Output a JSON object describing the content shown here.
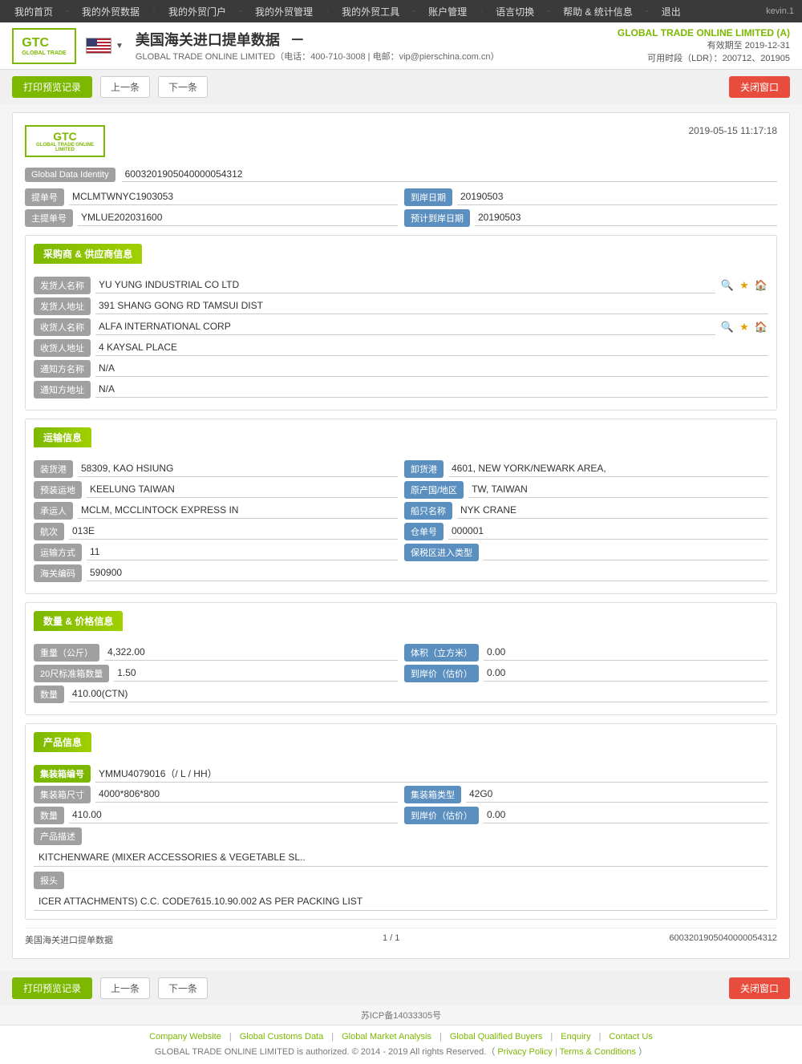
{
  "nav": {
    "items": [
      "我的首页",
      "我的外贸数据",
      "我的外贸门户",
      "我的外贸管理",
      "我的外贸工具",
      "账户管理",
      "语言切换",
      "帮助 & 统计信息",
      "退出"
    ],
    "user": "kevin.1"
  },
  "header": {
    "logo_text": "GTC",
    "logo_sub": "GLOBAL TRADE ONLINE LIMITED",
    "flag_alt": "US Flag",
    "title": "美国海关进口提单数据",
    "dash": "－",
    "subtitle": "GLOBAL TRADE ONLINE LIMITED（电话：400-710-3008 | 电邮：vip@pierschina.com.cn）",
    "company_name": "GLOBAL TRADE ONLINE LIMITED (A)",
    "valid_until": "有效期至 2019-12-31",
    "ldr": "可用时段（LDR）：200712、201905"
  },
  "toolbar": {
    "print_label": "打印预览记录",
    "prev_label": "上一条",
    "next_label": "下一条",
    "close_label": "关闭窗口"
  },
  "record": {
    "timestamp": "2019-05-15 11:17:18",
    "gdi_label": "Global Data Identity",
    "gdi_value": "6003201905040000054312",
    "bill_no_label": "提单号",
    "bill_no_value": "MCLMTWNYC1903053",
    "arrival_date_label": "到岸日期",
    "arrival_date_value": "20190503",
    "master_bill_label": "主提单号",
    "master_bill_value": "YMLUE202031600",
    "est_arrival_label": "预计到岸日期",
    "est_arrival_value": "20190503",
    "buyer_supplier": {
      "section_title": "采购商 & 供应商信息",
      "shipper_label": "发货人名称",
      "shipper_value": "YU YUNG INDUSTRIAL CO LTD",
      "shipper_addr_label": "发货人地址",
      "shipper_addr_value": "391 SHANG GONG RD TAMSUI DIST",
      "consignee_label": "收货人名称",
      "consignee_value": "ALFA INTERNATIONAL CORP",
      "consignee_addr_label": "收货人地址",
      "consignee_addr_value": "4 KAYSAL PLACE",
      "notify_label": "通知方名称",
      "notify_value": "N/A",
      "notify_addr_label": "通知方地址",
      "notify_addr_value": "N/A"
    },
    "transport": {
      "section_title": "运输信息",
      "loading_port_label": "装货港",
      "loading_port_value": "58309, KAO HSIUNG",
      "unloading_port_label": "卸货港",
      "unloading_port_value": "4601, NEW YORK/NEWARK AREA,",
      "pre_dest_label": "预装运地",
      "pre_dest_value": "KEELUNG TAIWAN",
      "origin_label": "原产国/地区",
      "origin_value": "TW, TAIWAN",
      "carrier_label": "承运人",
      "carrier_value": "MCLM, MCCLINTOCK EXPRESS IN",
      "vessel_label": "船只名称",
      "vessel_value": "NYK CRANE",
      "voyage_label": "航次",
      "voyage_value": "013E",
      "bill_no2_label": "仓单号",
      "bill_no2_value": "000001",
      "transport_mode_label": "运输方式",
      "transport_mode_value": "11",
      "ftz_label": "保税区进入类型",
      "ftz_value": "",
      "customs_code_label": "海关编码",
      "customs_code_value": "590900"
    },
    "quantity_price": {
      "section_title": "数量 & 价格信息",
      "weight_label": "重量（公斤）",
      "weight_value": "4,322.00",
      "volume_label": "体积（立方米）",
      "volume_value": "0.00",
      "std20_label": "20尺标准箱数量",
      "std20_value": "1.50",
      "landed_price_label": "到岸价（估价）",
      "landed_price_value": "0.00",
      "qty_label": "数量",
      "qty_value": "410.00(CTN)"
    },
    "product": {
      "section_title": "产品信息",
      "container_no_label": "集装箱编号",
      "container_no_value": "YMMU4079016（/ L / HH）",
      "container_size_label": "集装箱尺寸",
      "container_size_value": "4000*806*800",
      "container_type_label": "集装箱类型",
      "container_type_value": "42G0",
      "qty2_label": "数量",
      "qty2_value": "410.00",
      "landed_price2_label": "到岸价（估价）",
      "landed_price2_value": "0.00",
      "desc_label": "产品描述",
      "desc_value": "KITCHENWARE (MIXER ACCESSORIES & VEGETABLE SL..",
      "header_label": "报头",
      "header_value": "ICER ATTACHMENTS) C.C. CODE7615.10.90.002 AS PER PACKING LIST"
    },
    "footer": {
      "page_title": "美国海关进口提单数据",
      "page_num": "1 / 1",
      "record_id": "6003201905040000054312"
    }
  },
  "site_footer": {
    "icp": "苏ICP备14033305号",
    "links": [
      "Company Website",
      "Global Customs Data",
      "Global Market Analysis",
      "Global Qualified Buyers",
      "Enquiry",
      "Contact Us"
    ],
    "copyright": "GLOBAL TRADE ONLINE LIMITED is authorized. © 2014 - 2019 All rights Reserved.（",
    "privacy": "Privacy Policy",
    "terms": "Terms & Conditions",
    "end": "）"
  }
}
